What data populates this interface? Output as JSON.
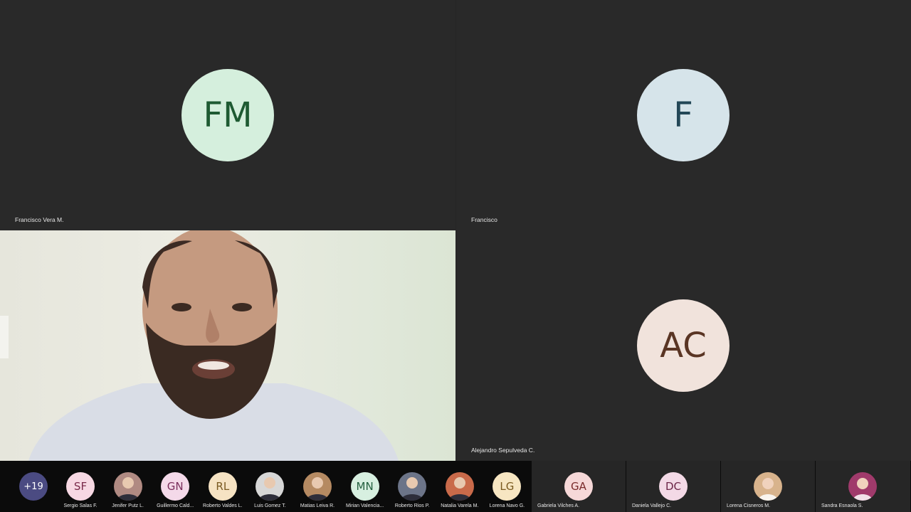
{
  "tiles": {
    "top_left": {
      "initials": "FM",
      "name": "Francisco Vera M.",
      "avatar_bg": "#d5efdd",
      "avatar_fg": "#1e5a32"
    },
    "top_right": {
      "initials": "F",
      "name": "Francisco",
      "avatar_bg": "#d6e4ea",
      "avatar_fg": "#234757"
    },
    "bottom_right": {
      "initials": "AC",
      "name": "Alejandro Sepulveda C.",
      "avatar_bg": "#f1e3dc",
      "avatar_fg": "#5a3524"
    }
  },
  "strip": {
    "overflow_count": "+19",
    "participants": [
      {
        "initials": "SF",
        "name": "Sergio Salas F.",
        "bg": "#f7d8e3",
        "fg": "#7a2a4a",
        "photo": false
      },
      {
        "initials": "",
        "name": "Jenifer Putz L.",
        "bg": "#b08a82",
        "fg": "#ffffff",
        "photo": true
      },
      {
        "initials": "GN",
        "name": "Guillermo Cald...",
        "bg": "#f4d9e9",
        "fg": "#7a2e5c",
        "photo": false
      },
      {
        "initials": "RL",
        "name": "Roberto Valdes L.",
        "bg": "#f6e3c3",
        "fg": "#7a5a22",
        "photo": false
      },
      {
        "initials": "",
        "name": "Luis Gomez T.",
        "bg": "#d7d7d7",
        "fg": "#333333",
        "photo": true
      },
      {
        "initials": "",
        "name": "Matias Leiva R.",
        "bg": "#b58a62",
        "fg": "#ffffff",
        "photo": true
      },
      {
        "initials": "MN",
        "name": "Mirian Valencia...",
        "bg": "#d7efe0",
        "fg": "#256140",
        "photo": false
      },
      {
        "initials": "",
        "name": "Roberto Rios P.",
        "bg": "#6c7488",
        "fg": "#ffffff",
        "photo": true
      },
      {
        "initials": "",
        "name": "Natalia Varela M.",
        "bg": "#c96a4a",
        "fg": "#ffffff",
        "photo": true
      },
      {
        "initials": "LG",
        "name": "Lorena Navo G.",
        "bg": "#f7e6c2",
        "fg": "#7a5a1f",
        "photo": false
      }
    ],
    "large": [
      {
        "initials": "GA",
        "name": "Gabriela Vilches A.",
        "bg": "#f6d8d8",
        "fg": "#7a2b2b",
        "photo": false
      },
      {
        "initials": "DC",
        "name": "Daniela Vallejo C.",
        "bg": "#f3d9e6",
        "fg": "#6d2648",
        "photo": false
      },
      {
        "initials": "",
        "name": "Lorena Cisneros M.",
        "bg": "#d8b38c",
        "fg": "#ffffff",
        "photo": true
      },
      {
        "initials": "",
        "name": "Sandra Esnaola S.",
        "bg": "#a03a6b",
        "fg": "#ffffff",
        "photo": true
      }
    ]
  }
}
